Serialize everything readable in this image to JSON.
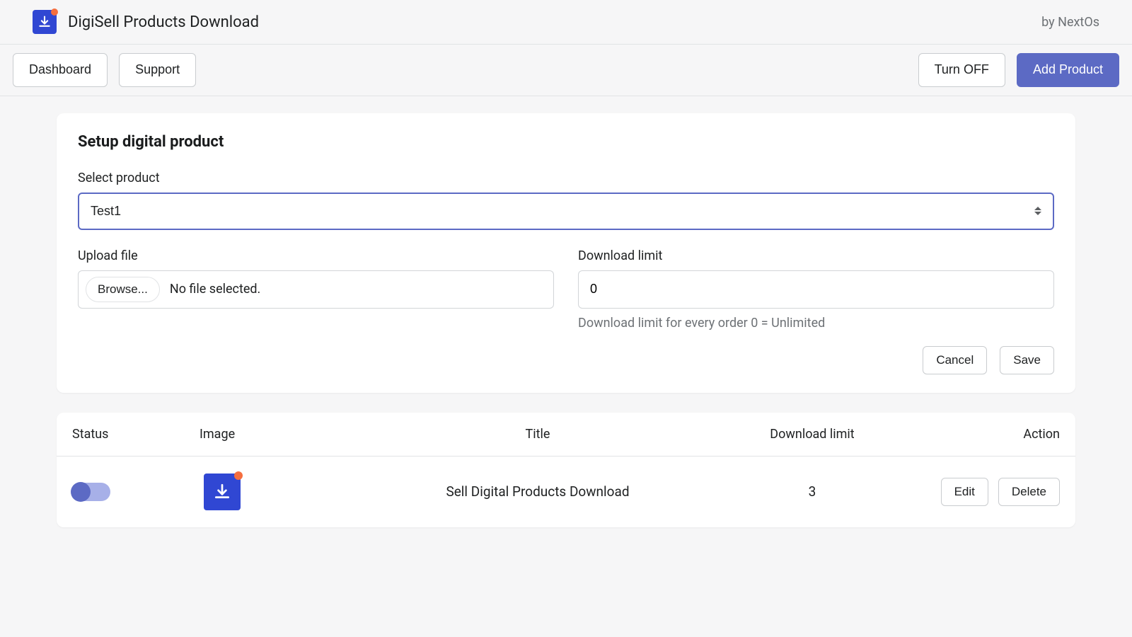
{
  "header": {
    "app_title": "DigiSell Products Download",
    "by_text": "by NextOs"
  },
  "toolbar": {
    "dashboard_label": "Dashboard",
    "support_label": "Support",
    "turn_off_label": "Turn OFF",
    "add_product_label": "Add Product"
  },
  "form": {
    "title": "Setup digital product",
    "select_label": "Select product",
    "select_value": "Test1",
    "upload_label": "Upload file",
    "browse_label": "Browse...",
    "no_file_text": "No file selected.",
    "limit_label": "Download limit",
    "limit_value": "0",
    "limit_help": "Download limit for every order 0 = Unlimited",
    "cancel_label": "Cancel",
    "save_label": "Save"
  },
  "table": {
    "headers": {
      "status": "Status",
      "image": "Image",
      "title": "Title",
      "limit": "Download limit",
      "action": "Action"
    },
    "rows": [
      {
        "title": "Sell Digital Products Download",
        "limit": "3",
        "edit_label": "Edit",
        "delete_label": "Delete"
      }
    ]
  }
}
